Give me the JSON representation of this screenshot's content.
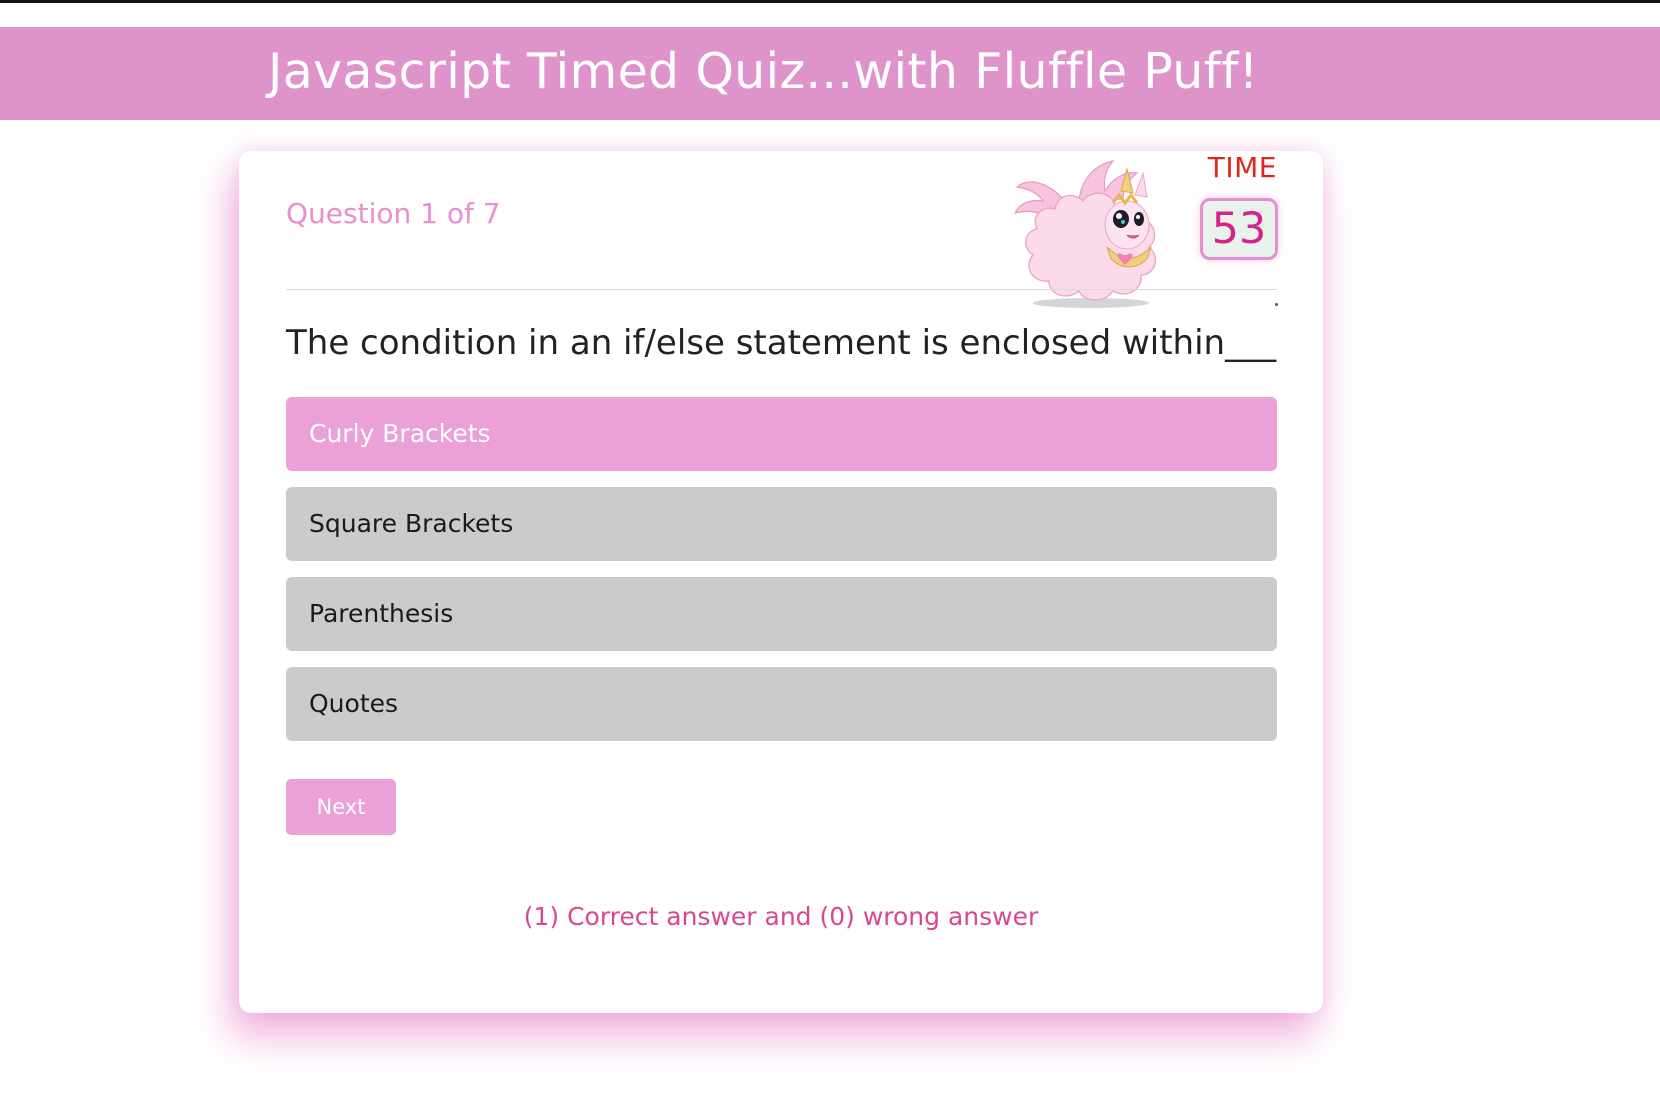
{
  "header": {
    "title": "Javascript Timed Quiz...with Fluffle Puff!"
  },
  "quiz": {
    "question_counter": "Question 1 of 7",
    "timer_label": "TIME",
    "timer_value": "53",
    "question": "The condition in an if/else statement is enclosed within___",
    "answers": [
      {
        "label": "Curly Brackets",
        "selected": true
      },
      {
        "label": "Square Brackets",
        "selected": false
      },
      {
        "label": "Parenthesis",
        "selected": false
      },
      {
        "label": "Quotes",
        "selected": false
      }
    ],
    "next_label": "Next",
    "score_text": "(1) Correct answer and (0) wrong answer"
  },
  "colors": {
    "header_bg": "#de93cb",
    "accent_pink": "#eba0d7",
    "answer_bg": "#cbcbcb",
    "time_label": "#e0261e",
    "timer_digits": "#d6228f",
    "score_text": "#d9478f"
  },
  "icons": {
    "mascot": "fluffle-puff-pony-image"
  }
}
